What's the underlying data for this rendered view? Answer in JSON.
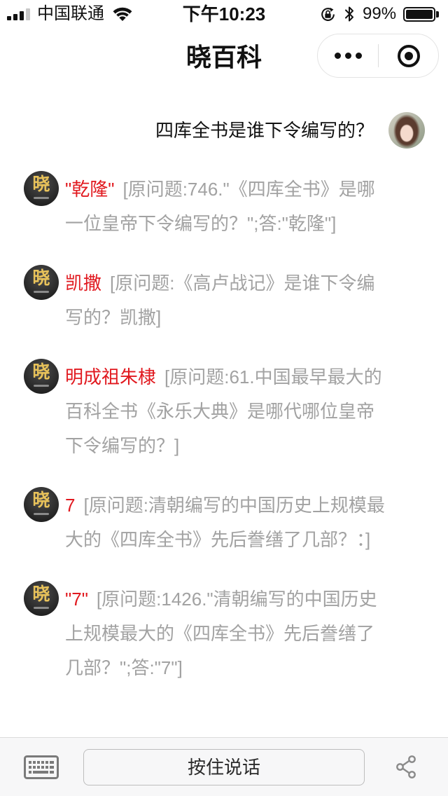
{
  "status_bar": {
    "carrier": "中国联通",
    "time": "下午10:23",
    "battery_text": "99%",
    "battery_level": 0.99,
    "signal_bars_filled": 3,
    "signal_bars_total": 4,
    "icons": [
      "signal-icon",
      "wifi-icon",
      "orientation-lock-icon",
      "bluetooth-icon",
      "battery-icon"
    ]
  },
  "nav_bar": {
    "title": "晓百科",
    "capsule_icons": [
      "more-dots-icon",
      "exit-target-icon"
    ]
  },
  "chat": {
    "user_message": {
      "text": "四库全书是谁下令编写的？",
      "avatar_icon": "user-avatar-photo"
    },
    "bot_avatar": {
      "logo_text": "晓"
    },
    "answers": [
      {
        "answer": "\"乾隆\"",
        "source": "[原问题:746.\"《四库全书》是哪一位皇帝下令编写的？\";答:\"乾隆\"]"
      },
      {
        "answer": "凯撒",
        "source": "[原问题:《高卢战记》是谁下令编写的？凯撒]"
      },
      {
        "answer": "明成祖朱棣",
        "source": "[原问题:61.中国最早最大的百科全书《永乐大典》是哪代哪位皇帝下令编写的？]"
      },
      {
        "answer": "7",
        "source": "[原问题:清朝编写的中国历史上规模最大的《四库全书》先后誊缮了几部？：]"
      },
      {
        "answer": "\"7\"",
        "source": "[原问题:1426.\"清朝编写的中国历史上规模最大的《四库全书》先后誊缮了几部？\";答:\"7\"]"
      }
    ]
  },
  "input_bar": {
    "keyboard_icon": "keyboard-icon",
    "voice_button_label": "按住说话",
    "share_icon": "share-icon"
  },
  "colors": {
    "answer": "#e1191f",
    "source": "#a2a2a2",
    "text": "#111111",
    "bot_logo": "#e8c25a",
    "input_bar_bg": "#f7f7f8"
  }
}
